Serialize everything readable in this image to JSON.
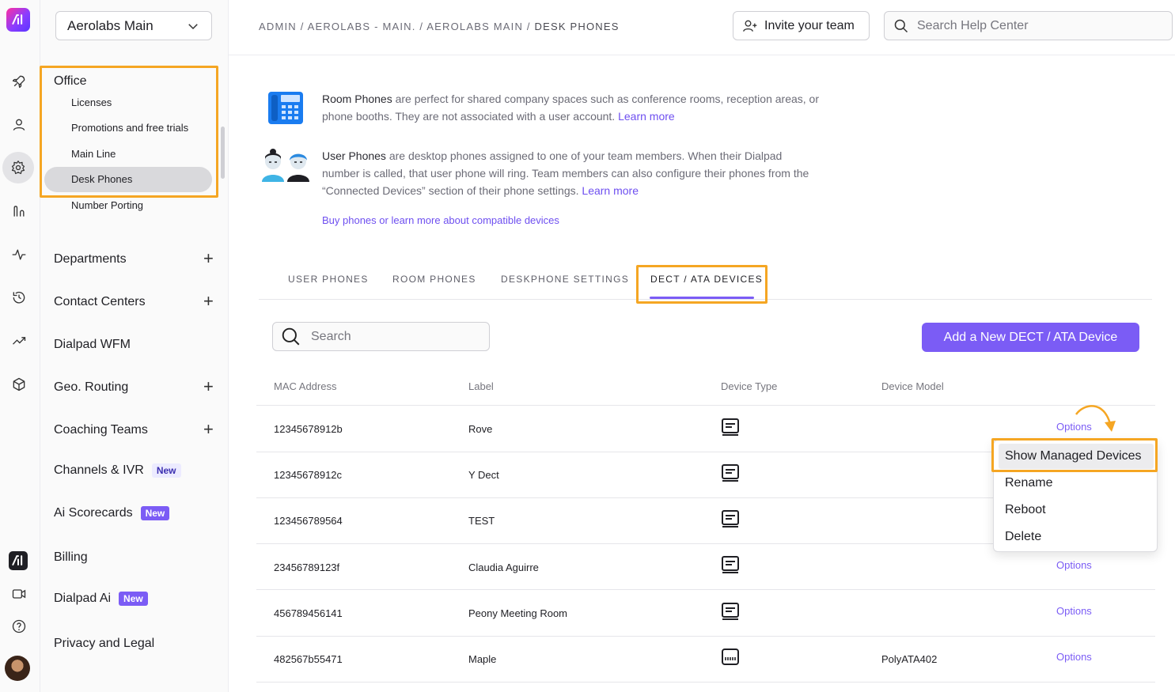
{
  "org_selector": {
    "value": "Aerolabs Main"
  },
  "sidebar": {
    "section_title": "Office",
    "sub_items": [
      "Licenses",
      "Promotions and free trials",
      "Main Line",
      "Desk Phones",
      "Number Porting"
    ],
    "items": [
      {
        "label": "Departments",
        "expandable": true
      },
      {
        "label": "Contact Centers",
        "expandable": true
      },
      {
        "label": "Dialpad WFM",
        "expandable": false
      },
      {
        "label": "Geo. Routing",
        "expandable": true
      },
      {
        "label": "Coaching Teams",
        "expandable": true
      },
      {
        "label": "Channels & IVR",
        "badge": "New"
      },
      {
        "label": "Ai Scorecards",
        "badge": "New"
      },
      {
        "label": "Billing"
      },
      {
        "label": "Dialpad Ai",
        "badge": "New"
      },
      {
        "label": "Privacy and Legal"
      }
    ]
  },
  "header": {
    "breadcrumb": "ADMIN / AEROLABS - MAIN. / AEROLABS MAIN / ",
    "breadcrumb_current": "DESK PHONES",
    "invite_label": "Invite your team",
    "help_search_placeholder": "Search Help Center"
  },
  "info": {
    "room_title": "Room Phones",
    "room_text": " are perfect for shared company spaces such as conference rooms, reception areas, or phone booths. They are not associated with a user account. ",
    "room_link": "Learn more",
    "user_title": "User Phones",
    "user_text": " are desktop phones assigned to one of your team members. When their Dialpad number is called, that user phone will ring. Team members can also configure their phones from the “Connected Devices” section of their phone settings. ",
    "user_link": "Learn more",
    "buy_link": "Buy phones or learn more about compatible devices"
  },
  "tabs": [
    "USER PHONES",
    "ROOM PHONES",
    "DESKPHONE SETTINGS",
    "DECT / ATA DEVICES"
  ],
  "search": {
    "placeholder": "Search"
  },
  "add_button": "Add a New DECT / ATA Device",
  "table": {
    "headers": [
      "MAC Address",
      "Label",
      "Device Type",
      "Device Model"
    ],
    "rows": [
      {
        "mac": "12345678912b",
        "label": "Rove",
        "type_icon": "dect-base-icon",
        "model": "",
        "options": "Options"
      },
      {
        "mac": "12345678912c",
        "label": "Y Dect",
        "type_icon": "dect-base-icon",
        "model": "",
        "options": ""
      },
      {
        "mac": "123456789564",
        "label": "TEST",
        "type_icon": "dect-base-icon",
        "model": "",
        "options": ""
      },
      {
        "mac": "23456789123f",
        "label": "Claudia Aguirre",
        "type_icon": "dect-base-icon",
        "model": "",
        "options": "Options"
      },
      {
        "mac": "456789456141",
        "label": "Peony Meeting Room",
        "type_icon": "dect-base-icon",
        "model": "",
        "options": "Options"
      },
      {
        "mac": "482567b55471",
        "label": "Maple",
        "type_icon": "ata-adapter-icon",
        "model": "PolyATA402",
        "options": "Options"
      }
    ]
  },
  "options_menu": [
    "Show Managed Devices",
    "Rename",
    "Reboot",
    "Delete"
  ],
  "colors": {
    "accent": "#7b5cf5",
    "highlight_box": "#f5a623"
  }
}
